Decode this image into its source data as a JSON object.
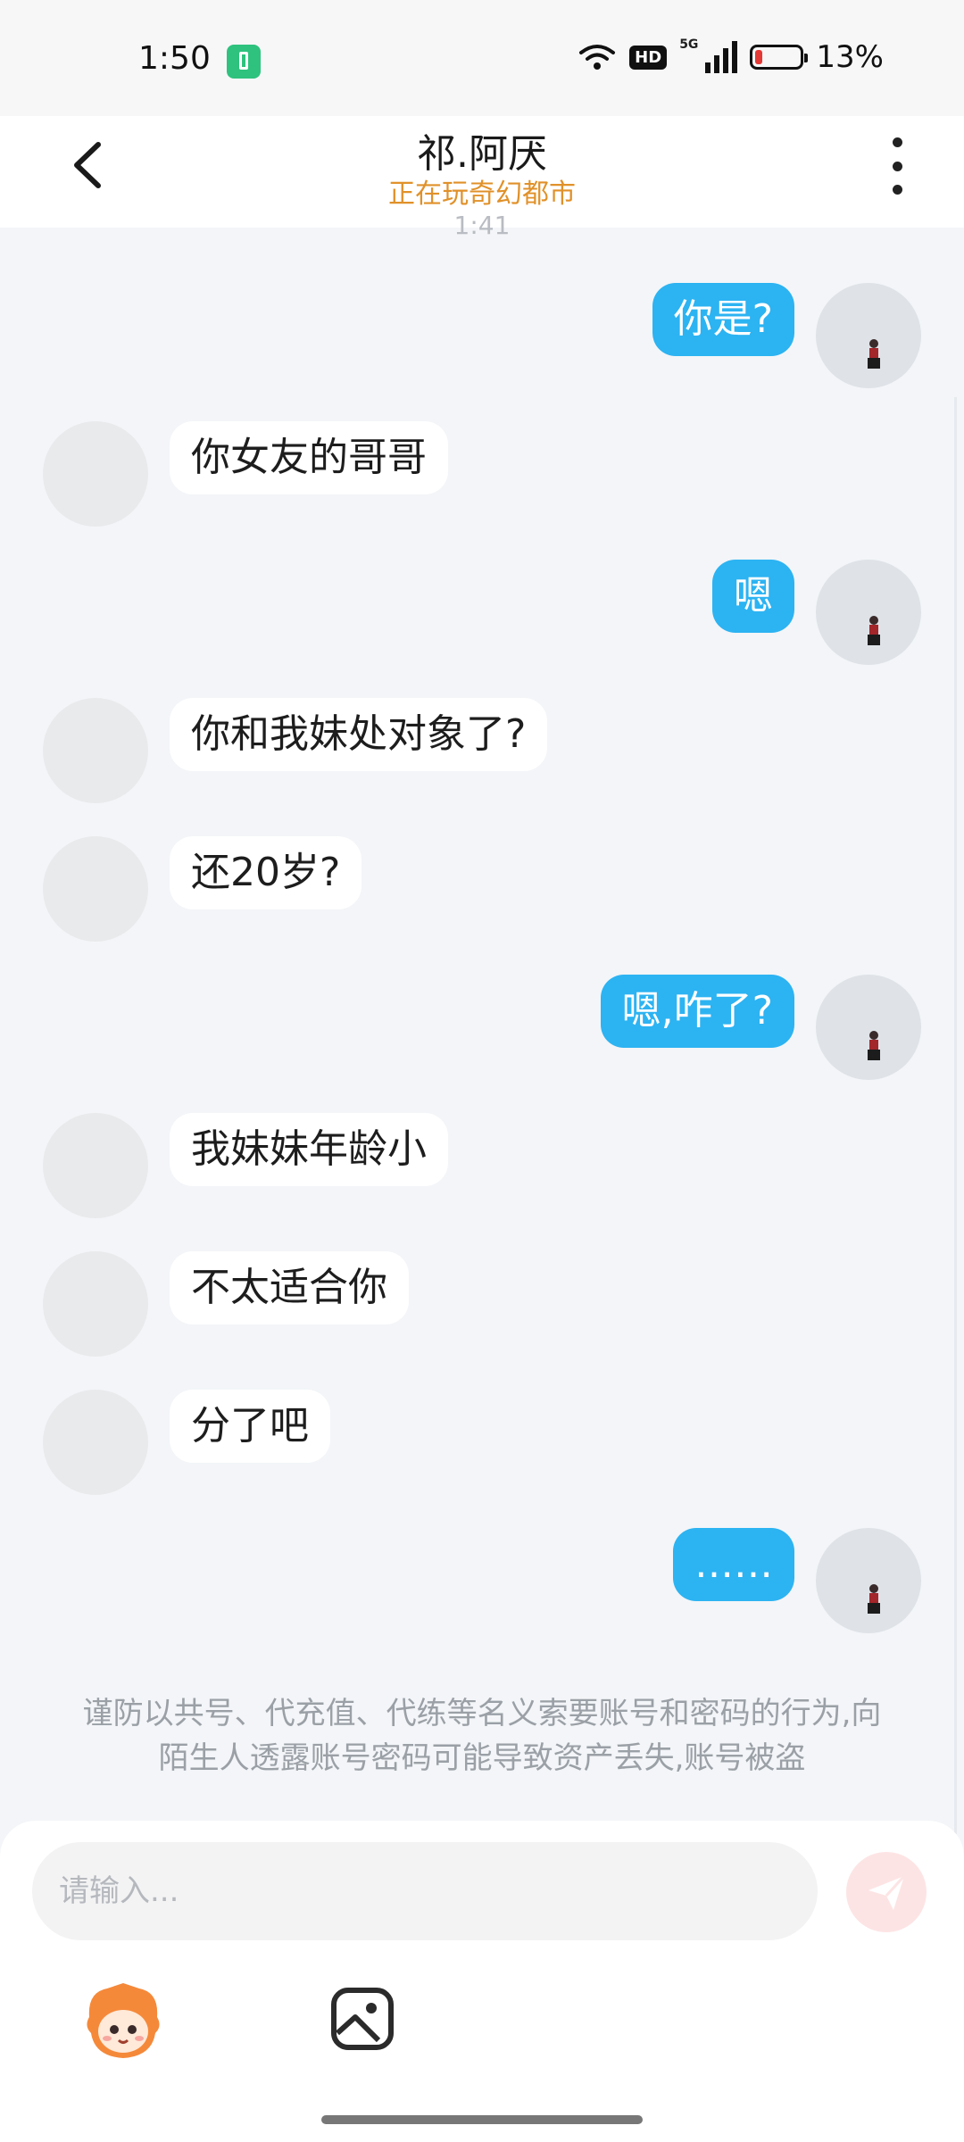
{
  "status_bar": {
    "time": "1:50",
    "network": "5G",
    "hd": "HD",
    "battery_percent": "13%"
  },
  "header": {
    "title": "祁.阿厌",
    "subtitle": "正在玩奇幻都市"
  },
  "timestamp_partial": "1:41",
  "messages": [
    {
      "side": "right",
      "text": "你是?"
    },
    {
      "side": "left",
      "text": "你女友的哥哥"
    },
    {
      "side": "right",
      "text": "嗯"
    },
    {
      "side": "left",
      "text": "你和我妹处对象了?"
    },
    {
      "side": "left",
      "text": "还20岁?"
    },
    {
      "side": "right",
      "text": "嗯,咋了?"
    },
    {
      "side": "left",
      "text": "我妹妹年龄小"
    },
    {
      "side": "left",
      "text": "不太适合你"
    },
    {
      "side": "left",
      "text": "分了吧"
    },
    {
      "side": "right",
      "text": "……"
    }
  ],
  "warning": "谨防以共号、代充值、代练等名义索要账号和密码的行为,向陌生人透露账号密码可能导致资产丢失,账号被盗",
  "input": {
    "placeholder": "请输入..."
  },
  "colors": {
    "outgoing_bubble": "#2cb3f2",
    "incoming_bubble": "#ffffff",
    "subtitle": "#e0912a",
    "background": "#f3f5f8"
  }
}
